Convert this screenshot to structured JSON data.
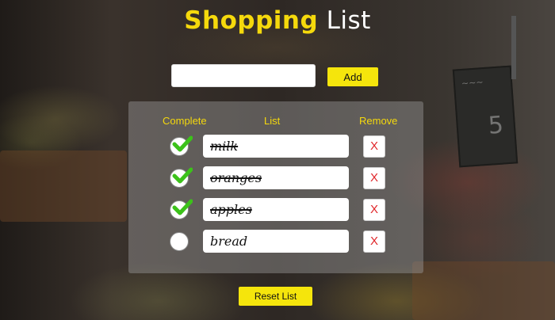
{
  "title": {
    "word1": "Shopping",
    "word2": "List"
  },
  "add_form": {
    "input_value": "",
    "button_label": "Add"
  },
  "columns": {
    "complete": "Complete",
    "list": "List",
    "remove": "Remove"
  },
  "items": [
    {
      "text": "milk",
      "complete": true,
      "remove_label": "X"
    },
    {
      "text": "oranges",
      "complete": true,
      "remove_label": "X"
    },
    {
      "text": "apples",
      "complete": true,
      "remove_label": "X"
    },
    {
      "text": "bread",
      "complete": false,
      "remove_label": "X"
    }
  ],
  "reset_label": "Reset List",
  "colors": {
    "accent_yellow": "#f5d90c",
    "check_green": "#3cc21a",
    "remove_red": "#e0262a"
  },
  "icons": {
    "complete": "checkmark-icon"
  }
}
